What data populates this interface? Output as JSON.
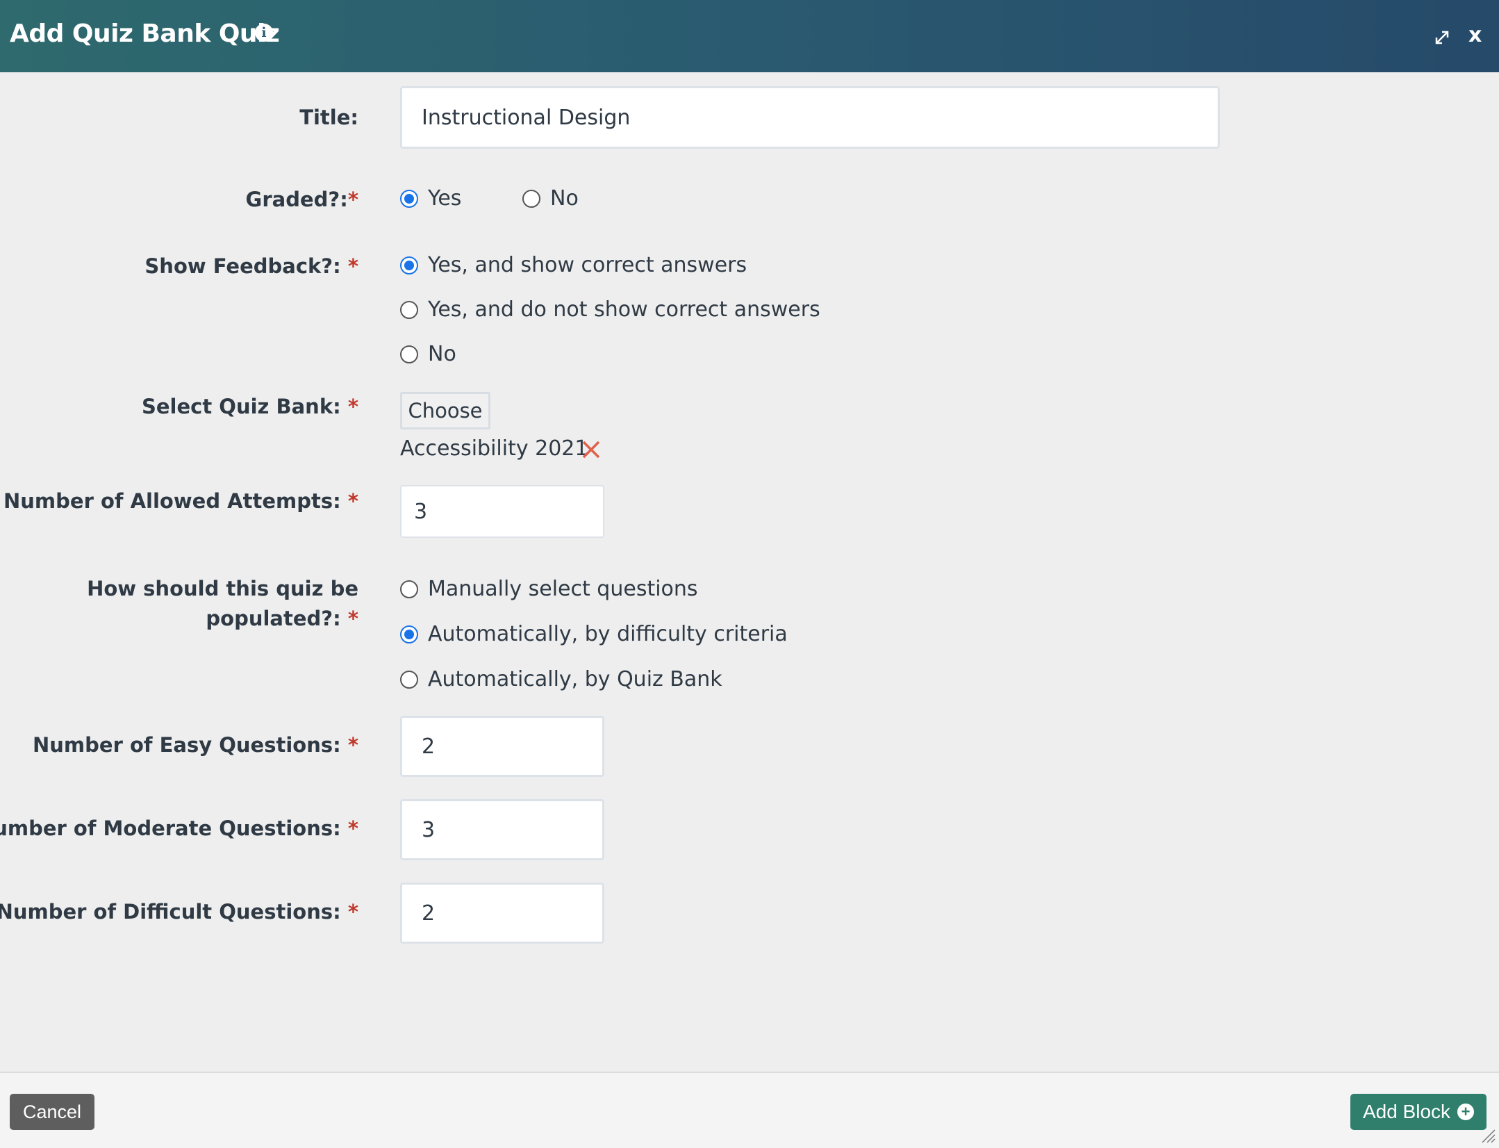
{
  "header": {
    "title": "Add Quiz Bank Quiz",
    "info_icon": "i",
    "close_label": "x"
  },
  "form": {
    "title": {
      "label": "Title:",
      "value": "Instructional Design"
    },
    "graded": {
      "label": "Graded?:",
      "required": "*",
      "options": [
        {
          "label": "Yes",
          "selected": true
        },
        {
          "label": "No",
          "selected": false
        }
      ]
    },
    "show_feedback": {
      "label": "Show Feedback?:",
      "required": "*",
      "options": [
        {
          "label": "Yes, and show correct answers",
          "selected": true
        },
        {
          "label": "Yes, and do not show correct answers",
          "selected": false
        },
        {
          "label": "No",
          "selected": false
        }
      ]
    },
    "quiz_bank": {
      "label": "Select Quiz Bank:",
      "required": "*",
      "choose_label": "Choose",
      "selected_bank": "Accessibility 2021"
    },
    "attempts": {
      "label": "Number of Allowed Attempts:",
      "required": "*",
      "value": "3"
    },
    "populate": {
      "label_line1": "How should this quiz be",
      "label_line2": "populated?:",
      "required": "*",
      "options": [
        {
          "label": "Manually select questions",
          "selected": false
        },
        {
          "label": "Automatically, by difficulty criteria",
          "selected": true
        },
        {
          "label": "Automatically, by Quiz Bank",
          "selected": false
        }
      ]
    },
    "easy": {
      "label": "Number of Easy Questions:",
      "required": "*",
      "value": "2"
    },
    "moderate": {
      "label": "Number of Moderate Questions:",
      "required": "*",
      "value": "3"
    },
    "difficult": {
      "label": "Number of Difficult Questions:",
      "required": "*",
      "value": "2"
    }
  },
  "footer": {
    "cancel_label": "Cancel",
    "add_label": "Add Block",
    "add_icon": "+"
  },
  "colors": {
    "header_start": "#2e6a6e",
    "header_end": "#264a6a",
    "required": "#c0392b",
    "radio_selected": "#1a73e8",
    "add_button": "#2f7f6c",
    "cancel_button": "#5e5e5e",
    "remove_icon": "#e0604a"
  }
}
